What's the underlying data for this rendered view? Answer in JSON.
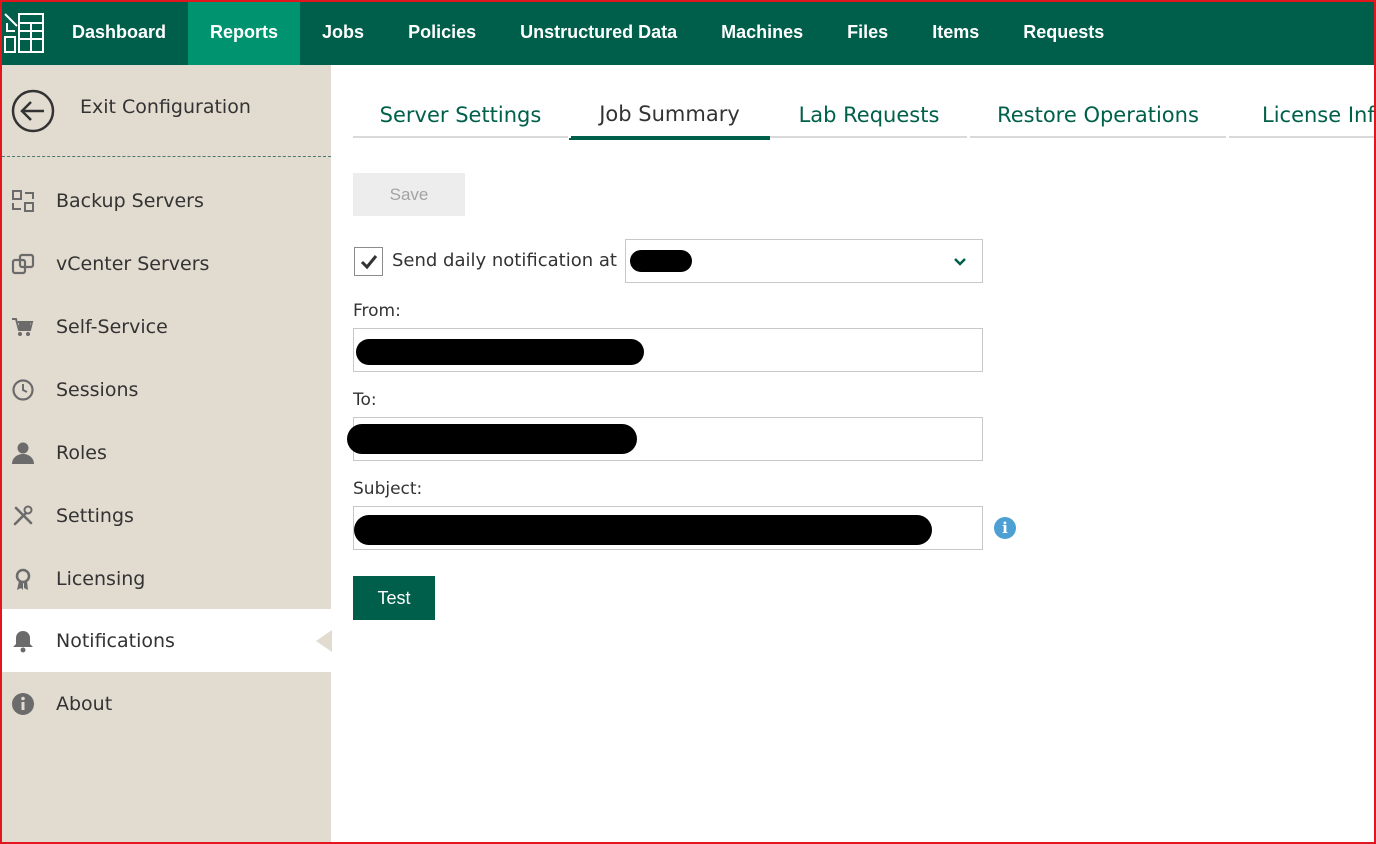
{
  "nav": {
    "items": [
      {
        "label": "Dashboard"
      },
      {
        "label": "Reports"
      },
      {
        "label": "Jobs"
      },
      {
        "label": "Policies"
      },
      {
        "label": "Unstructured Data"
      },
      {
        "label": "Machines"
      },
      {
        "label": "Files"
      },
      {
        "label": "Items"
      },
      {
        "label": "Requests"
      }
    ],
    "active": "Reports"
  },
  "sidebar": {
    "exit_label": "Exit Configuration",
    "items": [
      {
        "label": "Backup Servers",
        "icon": "backup-servers-icon"
      },
      {
        "label": "vCenter Servers",
        "icon": "vcenter-icon"
      },
      {
        "label": "Self-Service",
        "icon": "cart-icon"
      },
      {
        "label": "Sessions",
        "icon": "clock-icon"
      },
      {
        "label": "Roles",
        "icon": "user-icon"
      },
      {
        "label": "Settings",
        "icon": "tools-icon"
      },
      {
        "label": "Licensing",
        "icon": "license-icon"
      },
      {
        "label": "Notifications",
        "icon": "bell-icon"
      },
      {
        "label": "About",
        "icon": "info-icon"
      }
    ],
    "active": "Notifications"
  },
  "tabs": {
    "items": [
      {
        "label": "Server Settings"
      },
      {
        "label": "Job Summary"
      },
      {
        "label": "Lab Requests"
      },
      {
        "label": "Restore Operations"
      },
      {
        "label": "License Info"
      }
    ],
    "active": "Job Summary"
  },
  "form": {
    "save_label": "Save",
    "send_daily_label": "Send daily notification at",
    "send_daily_checked": true,
    "from_label": "From:",
    "to_label": "To:",
    "subject_label": "Subject:",
    "test_label": "Test"
  },
  "colors": {
    "nav_bg": "#005f4b",
    "nav_active": "#00936f",
    "sidebar_bg": "#e2dbd0",
    "accent": "#005f4b",
    "info": "#4d9fd4"
  }
}
